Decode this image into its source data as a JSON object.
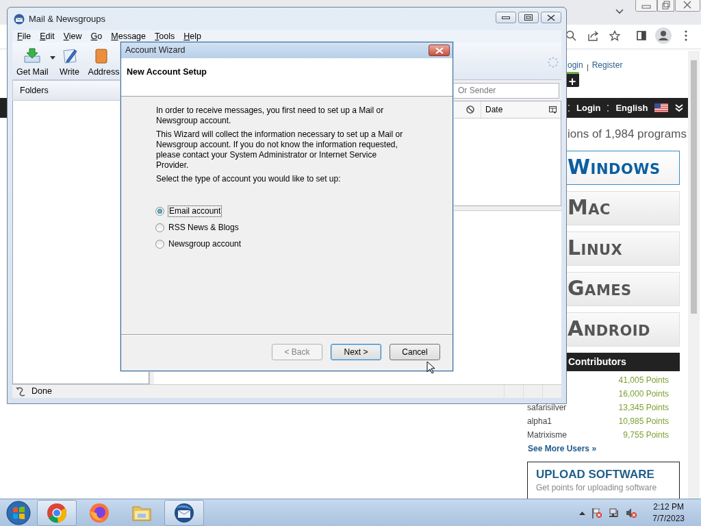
{
  "browser": {
    "header_links": [
      "ogin",
      "Register"
    ],
    "plus_button": "+",
    "nav": [
      "Login",
      "English"
    ],
    "headline": "ions of 1,984 programs",
    "platforms": [
      {
        "label": "Windows",
        "selected": true
      },
      {
        "label": "Mac",
        "selected": false
      },
      {
        "label": "Linux",
        "selected": false
      },
      {
        "label": "Games",
        "selected": false
      },
      {
        "label": "Android",
        "selected": false
      }
    ],
    "contributors": {
      "title": "Contributors",
      "rows": [
        {
          "points": "41,005 Points"
        },
        {
          "points": "16,000 Points"
        },
        {
          "name": "safarisilver",
          "points": "13,345 Points"
        },
        {
          "name": "alpha1",
          "points": "10,985 Points"
        },
        {
          "name": "Matrixisme",
          "points": "9,755 Points"
        }
      ]
    },
    "see_more": "See More Users »",
    "upload": {
      "title": "UPLOAD SOFTWARE",
      "text": "Get points for uploading software"
    }
  },
  "mail_window": {
    "title": "Mail & Newsgroups",
    "menu": [
      "File",
      "Edit",
      "View",
      "Go",
      "Message",
      "Tools",
      "Help"
    ],
    "toolbar": [
      {
        "label": "Get Mail",
        "kind": "getmail",
        "dropdown": true
      },
      {
        "label": "Write",
        "kind": "write",
        "dropdown": false
      },
      {
        "label": "Address",
        "kind": "address",
        "dropdown": false
      }
    ],
    "folders_header": "Folders",
    "search": {
      "placeholder": "Or Sender"
    },
    "columns": [
      "Date"
    ],
    "status": "Done"
  },
  "dialog": {
    "title": "Account Wizard",
    "heading": "New Account Setup",
    "paragraphs": [
      "In order to receive messages, you first need to set up a Mail or Newsgroup account.",
      "This Wizard will collect the information necessary to set up a Mail or Newsgroup account. If you do not know the information requested, please contact your System Administrator or Internet Service Provider.",
      "Select the type of account you would like to set up:"
    ],
    "options": [
      {
        "label": "Email account",
        "selected": true
      },
      {
        "label": "RSS News & Blogs",
        "selected": false
      },
      {
        "label": "Newsgroup account",
        "selected": false
      }
    ],
    "buttons": [
      {
        "label": "< Back",
        "disabled": true,
        "default": false
      },
      {
        "label": "Next >",
        "disabled": false,
        "default": true
      },
      {
        "label": "Cancel",
        "disabled": false,
        "default": false
      }
    ]
  },
  "taskbar": {
    "apps": [
      {
        "kind": "chrome",
        "running": true
      },
      {
        "kind": "firefox",
        "running": false
      },
      {
        "kind": "explorer",
        "running": false
      },
      {
        "kind": "mail",
        "running": true
      }
    ],
    "time": "2:12 PM",
    "date": "7/7/2023"
  }
}
